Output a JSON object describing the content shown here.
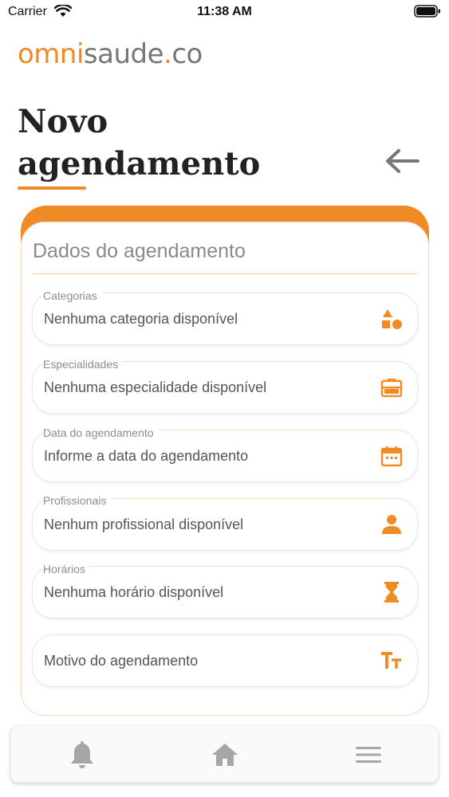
{
  "status_bar": {
    "carrier": "Carrier",
    "time": "11:38 AM",
    "icons": [
      "wifi-icon",
      "battery-icon"
    ]
  },
  "logo": {
    "part1": "omni",
    "part2": "saude",
    "part3": ".",
    "part4": "co"
  },
  "header": {
    "title": "Novo agendamento",
    "back_icon": "arrow-left-icon"
  },
  "form": {
    "section_title": "Dados do agendamento",
    "fields": [
      {
        "label": "Categorias",
        "value": "Nenhuma categoria disponível",
        "icon": "shapes-icon"
      },
      {
        "label": "Especialidades",
        "value": "Nenhuma especialidade disponível",
        "icon": "briefcase-icon"
      },
      {
        "label": "Data do agendamento",
        "value": "Informe a data do agendamento",
        "icon": "calendar-icon"
      },
      {
        "label": "Profissionais",
        "value": "Nenhum profissional disponível",
        "icon": "person-icon"
      },
      {
        "label": "Horários",
        "value": "Nenhuma horário disponível",
        "icon": "hourglass-icon"
      },
      {
        "label": "",
        "value": "Motivo do agendamento",
        "icon": "text-size-icon"
      }
    ]
  },
  "bottom_nav": {
    "items": [
      "bell-icon",
      "home-icon",
      "menu-icon"
    ]
  },
  "colors": {
    "accent": "#f08a24",
    "logo_gray": "#777777",
    "text": "#555555",
    "nav_icon": "#a6a6a6"
  }
}
